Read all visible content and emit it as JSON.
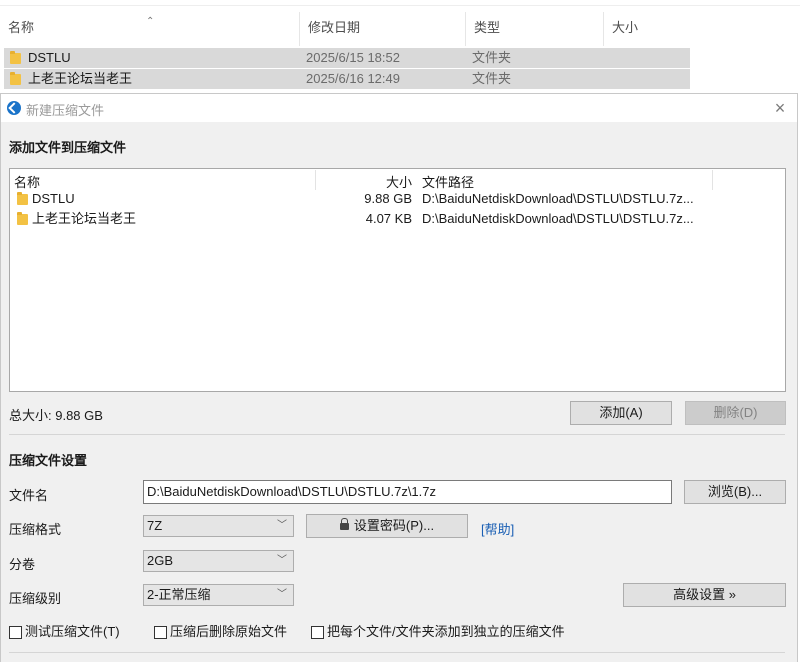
{
  "explorer": {
    "columns": {
      "name": "名称",
      "modified": "修改日期",
      "type": "类型",
      "size": "大小"
    },
    "rows": [
      {
        "name": "DSTLU",
        "modified": "2025/6/15 18:52",
        "type": "文件夹"
      },
      {
        "name": "上老王论坛当老王",
        "modified": "2025/6/16 12:49",
        "type": "文件夹"
      }
    ]
  },
  "dialog": {
    "title": "新建压缩文件",
    "close": "×",
    "add_section": "添加文件到压缩文件",
    "list_headers": {
      "name": "名称",
      "size": "大小",
      "path": "文件路径"
    },
    "files": [
      {
        "name": "DSTLU",
        "size": "9.88 GB",
        "path": "D:\\BaiduNetdiskDownload\\DSTLU\\DSTLU.7z..."
      },
      {
        "name": "上老王论坛当老王",
        "size": "4.07 KB",
        "path": "D:\\BaiduNetdiskDownload\\DSTLU\\DSTLU.7z..."
      }
    ],
    "total_size": "总大小: 9.88 GB",
    "add_button": "添加(A)",
    "delete_button": "删除(D)",
    "settings_section": "压缩文件设置",
    "filename_label": "文件名",
    "filename_value": "D:\\BaiduNetdiskDownload\\DSTLU\\DSTLU.7z\\1.7z",
    "browse_button": "浏览(B)...",
    "format_label": "压缩格式",
    "format_value": "7Z",
    "password_button": "设置密码(P)...",
    "help_link": "[帮助]",
    "volume_label": "分卷",
    "volume_value": "2GB",
    "level_label": "压缩级别",
    "level_value": "2-正常压缩",
    "advanced_button": "高级设置 »",
    "checkboxes": [
      {
        "label": "测试压缩文件(T)",
        "checked": false
      },
      {
        "label": "压缩后删除原始文件",
        "checked": false
      },
      {
        "label": "把每个文件/文件夹添加到独立的压缩文件",
        "checked": false
      }
    ]
  }
}
